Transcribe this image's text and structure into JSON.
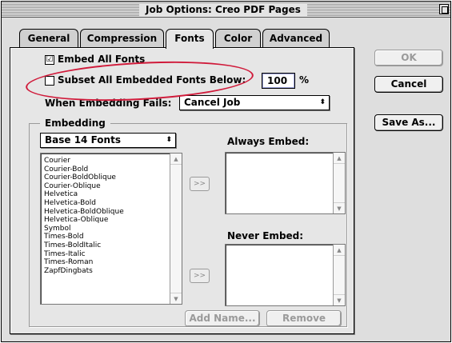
{
  "window": {
    "title": "Job Options: Creo PDF Pages"
  },
  "tabs": [
    {
      "label": "General"
    },
    {
      "label": "Compression"
    },
    {
      "label": "Fonts"
    },
    {
      "label": "Color"
    },
    {
      "label": "Advanced"
    }
  ],
  "fonts_tab": {
    "embed_all": {
      "label": "Embed All Fonts",
      "checked": true,
      "check_glyph": "☑"
    },
    "subset": {
      "label": "Subset All Embedded Fonts Below:",
      "checked": false,
      "value": "100",
      "unit": "%"
    },
    "when_fails": {
      "label": "When Embedding Fails:",
      "selected": "Cancel Job"
    },
    "embedding": {
      "group_label": "Embedding",
      "source_selected": "Base 14 Fonts",
      "font_list": [
        "Courier",
        "Courier-Bold",
        "Courier-BoldOblique",
        "Courier-Oblique",
        "Helvetica",
        "Helvetica-Bold",
        "Helvetica-BoldOblique",
        "Helvetica-Oblique",
        "Symbol",
        "Times-Bold",
        "Times-BoldItalic",
        "Times-Italic",
        "Times-Roman",
        "ZapfDingbats"
      ],
      "always_embed_label": "Always Embed:",
      "never_embed_label": "Never Embed:",
      "move_glyph": ">>",
      "add_name": "Add Name...",
      "remove": "Remove"
    }
  },
  "buttons": {
    "ok": "OK",
    "cancel": "Cancel",
    "save_as": "Save As..."
  },
  "icons": {
    "dropdown": "▲▼-arrows-icon",
    "scroll_up": "▲",
    "scroll_down": "▼"
  },
  "annotation_color": "#d01a3a"
}
